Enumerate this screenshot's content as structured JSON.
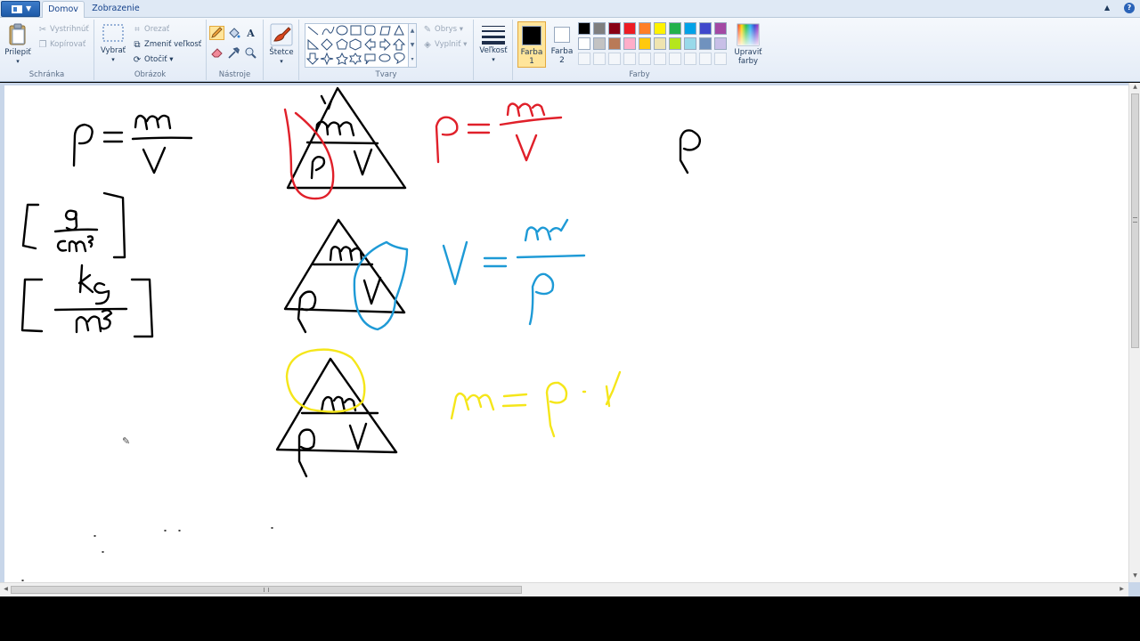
{
  "tabs": {
    "home": "Domov",
    "view": "Zobrazenie"
  },
  "clipboard": {
    "paste": "Prilepiť",
    "cut": "Vystrihnúť",
    "copy": "Kopírovať",
    "label": "Schránka"
  },
  "image": {
    "select": "Vybrať",
    "crop": "Orezať",
    "resize": "Zmeniť veľkosť",
    "rotate": "Otočiť",
    "label": "Obrázok"
  },
  "tools": {
    "label": "Nástroje"
  },
  "brushes": {
    "label": "Štetce"
  },
  "shapes": {
    "outline": "Obrys",
    "fill": "Vyplniť",
    "label": "Tvary"
  },
  "size": {
    "label": "Veľkosť"
  },
  "colors": {
    "color1": "Farba",
    "color1_num": "1",
    "color2": "Farba",
    "color2_num": "2",
    "edit": "Upraviť",
    "edit2": "farby",
    "label": "Farby",
    "palette_row1": [
      "#000000",
      "#7f7f7f",
      "#880015",
      "#ed1c24",
      "#ff7f27",
      "#fff200",
      "#22b14c",
      "#00a2e8",
      "#3f48cc",
      "#a349a4"
    ],
    "palette_row2": [
      "#ffffff",
      "#c3c3c3",
      "#b97a57",
      "#ffaec9",
      "#ffc90e",
      "#efe4b0",
      "#b5e61d",
      "#99d9ea",
      "#7092be",
      "#c8bfe7"
    ],
    "ink_black": "#000000",
    "ink_red": "#e0202a",
    "ink_blue": "#1e9ad6",
    "ink_yellow": "#f5e61a"
  }
}
